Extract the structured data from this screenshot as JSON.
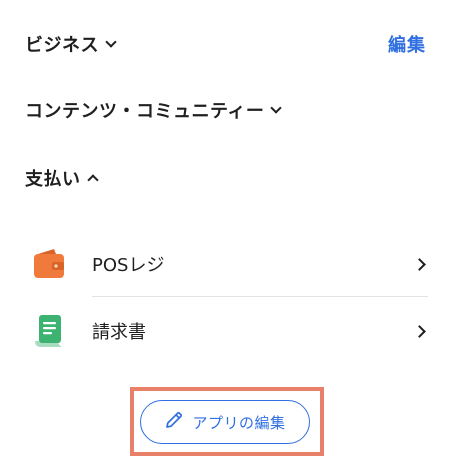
{
  "sections": {
    "business": {
      "label": "ビジネス",
      "expanded": false
    },
    "content_community": {
      "label": "コンテンツ・コミュニティー",
      "expanded": false
    },
    "payments": {
      "label": "支払い",
      "expanded": true
    }
  },
  "header": {
    "edit_label": "編集"
  },
  "apps": [
    {
      "label": "POSレジ",
      "icon": "wallet-icon",
      "color": "#ef7a3b"
    },
    {
      "label": "請求書",
      "icon": "invoice-icon",
      "color": "#3cb371"
    }
  ],
  "footer": {
    "edit_apps_label": "アプリの編集",
    "icon": "pencil-icon"
  },
  "colors": {
    "accent": "#2f6fe0",
    "highlight": "#e8806a"
  }
}
